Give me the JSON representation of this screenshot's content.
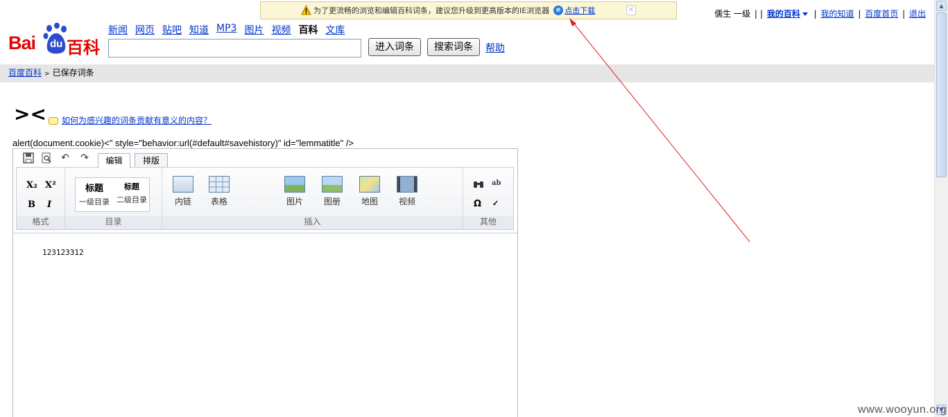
{
  "notice": {
    "text": "为了更流畅的浏览和编辑百科词条，建议您升级到更高版本的IE浏览器",
    "link": "点击下载",
    "ie_glyph": "e"
  },
  "userbar": {
    "username": "儒生",
    "level": "一级",
    "my_baike": "我的百科",
    "my_zhidao": "我的知道",
    "baidu_home": "百度首页",
    "logout": "退出"
  },
  "logo": {
    "bai": "Bai",
    "du": "du",
    "baike": "百科"
  },
  "nav": {
    "items": [
      "新闻",
      "网页",
      "贴吧",
      "知道",
      "MP3",
      "图片",
      "视频"
    ],
    "current": "百科",
    "last": "文库"
  },
  "search": {
    "value": "",
    "enter_label": "进入词条",
    "search_label": "搜索词条",
    "help": "帮助"
  },
  "breadcrumb": {
    "root": "百度百科",
    "current": "已保存词条"
  },
  "title": "><",
  "howto_link": "如何为感兴趣的词条贡献有意义的内容？",
  "leaked_text": "alert(document.cookie)<\" style=\"behavior:url(#default#savehistory)\" id=\"lemmatitle\" />",
  "editor": {
    "tabs": [
      "编辑",
      "排版"
    ],
    "groups": {
      "format": "格式",
      "toc": "目录",
      "insert": "插入",
      "other": "其他"
    },
    "format_buttons": {
      "sub": "X₂",
      "sup": "X²",
      "bold": "B",
      "italic": "I"
    },
    "headings": [
      {
        "title": "标题",
        "label": "一级目录"
      },
      {
        "title": "标题",
        "label": "二级目录"
      }
    ],
    "insert_buttons": [
      "内链",
      "表格",
      "图片",
      "图册",
      "地图",
      "视频"
    ],
    "other_buttons": {
      "find": "🔍",
      "replace": "ab",
      "omega": "Ω",
      "spell": "✓"
    },
    "content": "123123312"
  },
  "colors": {
    "brand_red": "#e10601",
    "link_blue": "#0033cc",
    "annotation_red": "#e02020"
  },
  "watermark": "www.wooyun.org"
}
